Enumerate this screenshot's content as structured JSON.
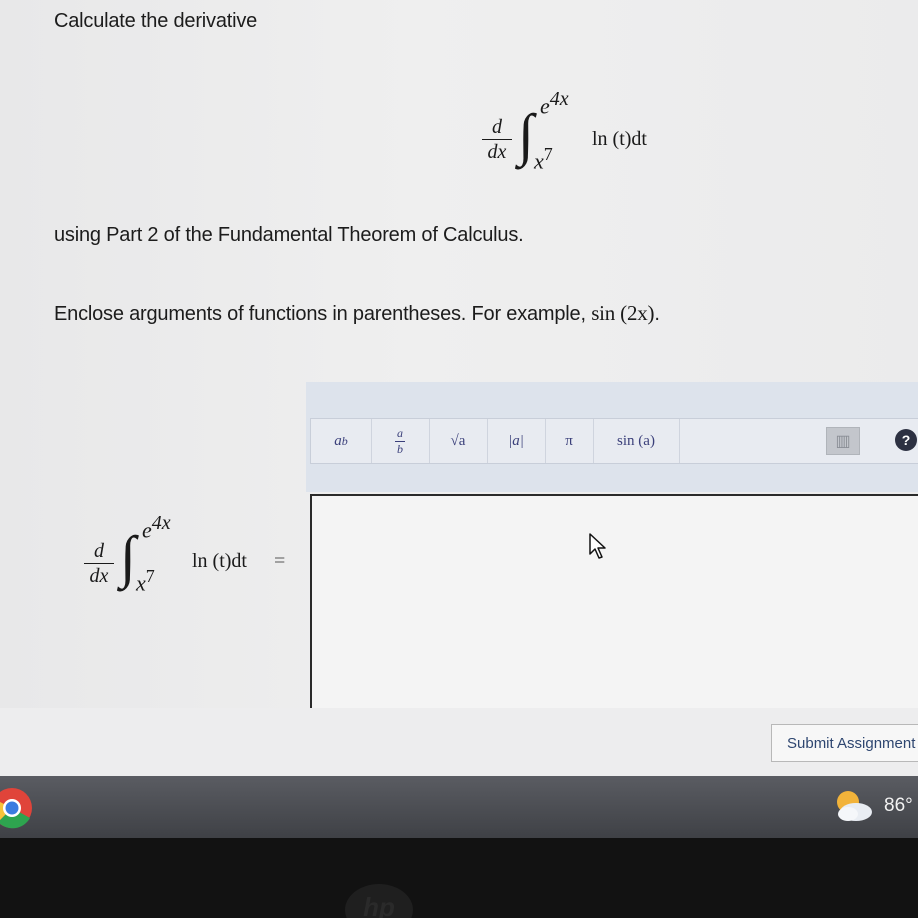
{
  "question": {
    "title": "Calculate the derivative",
    "part_text": "using Part 2 of the Fundamental Theorem of Calculus.",
    "hint_prefix": "Enclose arguments of functions in parentheses. For example, ",
    "hint_example": "sin (2x)",
    "hint_suffix": "."
  },
  "equation": {
    "d": "d",
    "dx": "dx",
    "upper_base": "e",
    "upper_exp": "4x",
    "lower_var": "x",
    "lower_exp": "7",
    "integrand": "ln (t)dt",
    "equals": "="
  },
  "toolbar": {
    "buttons": [
      {
        "base": "a",
        "sup": "b"
      },
      {
        "num": "a",
        "den": "b"
      },
      {
        "label": "√a"
      },
      {
        "label": "|a|"
      },
      {
        "label": "π"
      },
      {
        "label": "sin (a)"
      }
    ],
    "help_label": "?"
  },
  "answer": {
    "value": ""
  },
  "submit_label": "Submit Assignment",
  "taskbar": {
    "temperature": "86°"
  },
  "colors": {
    "accent": "#3a3f7a",
    "submit_text": "#2e4670",
    "taskbar": "#4a4c52"
  }
}
